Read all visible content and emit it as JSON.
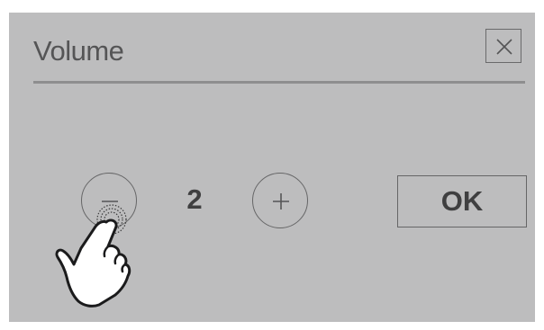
{
  "dialog": {
    "title": "Volume",
    "close_icon": "close-icon"
  },
  "stepper": {
    "decrement_icon": "minus-icon",
    "value": "2",
    "increment_icon": "plus-icon"
  },
  "actions": {
    "ok_label": "OK"
  },
  "cursor": {
    "icon": "pointing-hand-icon",
    "tapping": "minus-button"
  },
  "colors": {
    "dialog_background": "#bdbdbe",
    "page_background": "#ffffff",
    "title_text": "#555556",
    "body_text": "#3f3f40",
    "outline": "#666667"
  }
}
